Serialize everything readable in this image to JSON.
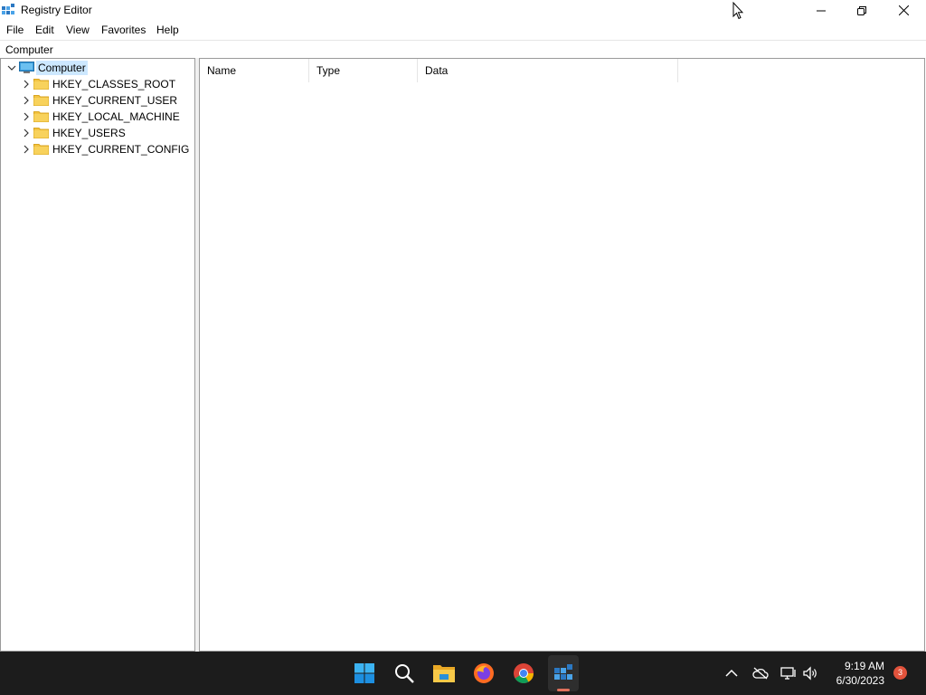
{
  "window": {
    "title": "Registry Editor"
  },
  "menu": {
    "items": [
      "File",
      "Edit",
      "View",
      "Favorites",
      "Help"
    ]
  },
  "address": {
    "path": "Computer"
  },
  "tree": {
    "root_label": "Computer",
    "keys": [
      {
        "label": "HKEY_CLASSES_ROOT"
      },
      {
        "label": "HKEY_CURRENT_USER"
      },
      {
        "label": "HKEY_LOCAL_MACHINE"
      },
      {
        "label": "HKEY_USERS"
      },
      {
        "label": "HKEY_CURRENT_CONFIG"
      }
    ]
  },
  "list": {
    "columns": [
      "Name",
      "Type",
      "Data"
    ]
  },
  "taskbar": {
    "time": "9:19 AM",
    "date": "6/30/2023",
    "notification_count": "3",
    "apps": [
      "start-icon",
      "search-icon",
      "file-explorer-icon",
      "firefox-icon",
      "chrome-icon",
      "registry-editor-icon"
    ]
  },
  "colors": {
    "selection": "#cde8ff",
    "taskbar_bg": "#1c1c1c",
    "badge": "#e2533c",
    "folder": "#f3c443"
  }
}
